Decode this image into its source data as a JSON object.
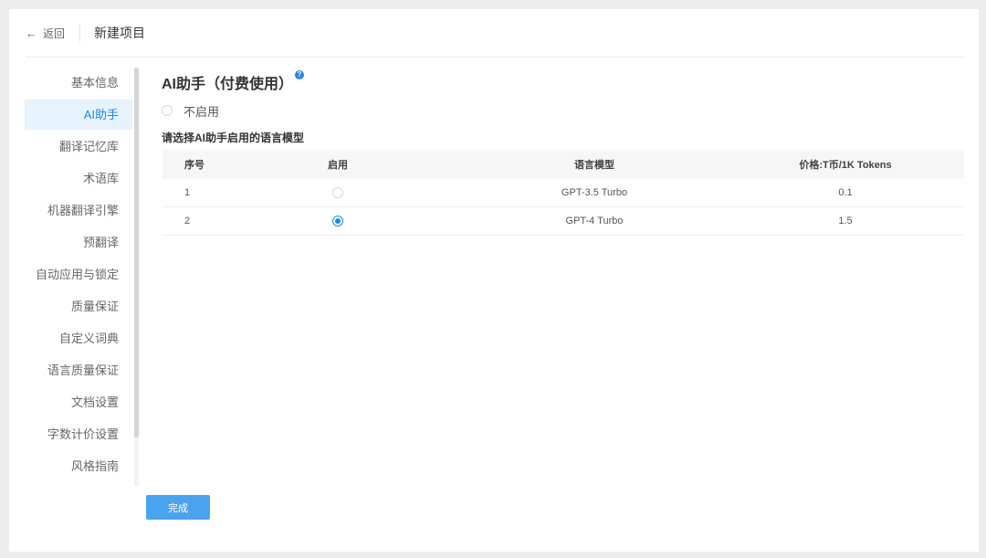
{
  "header": {
    "back_label": "返回",
    "title": "新建项目"
  },
  "sidebar": {
    "items": [
      {
        "label": "基本信息",
        "active": false
      },
      {
        "label": "AI助手",
        "active": true
      },
      {
        "label": "翻译记忆库",
        "active": false
      },
      {
        "label": "术语库",
        "active": false
      },
      {
        "label": "机器翻译引擎",
        "active": false
      },
      {
        "label": "预翻译",
        "active": false
      },
      {
        "label": "自动应用与锁定",
        "active": false
      },
      {
        "label": "质量保证",
        "active": false
      },
      {
        "label": "自定义词典",
        "active": false
      },
      {
        "label": "语言质量保证",
        "active": false
      },
      {
        "label": "文档设置",
        "active": false
      },
      {
        "label": "字数计价设置",
        "active": false
      },
      {
        "label": "风格指南",
        "active": false
      }
    ]
  },
  "main": {
    "title": "AI助手（付费使用）",
    "help_icon": "question-icon",
    "disable_option": "不启用",
    "model_section_label": "请选择AI助手启用的语言模型",
    "table": {
      "columns": [
        "序号",
        "启用",
        "语言模型",
        "价格:T币/1K Tokens"
      ],
      "rows": [
        {
          "index": "1",
          "enabled": false,
          "model": "GPT-3.5 Turbo",
          "price": "0.1"
        },
        {
          "index": "2",
          "enabled": true,
          "model": "GPT-4 Turbo",
          "price": "1.5"
        }
      ]
    }
  },
  "footer": {
    "done_label": "完成"
  },
  "colors": {
    "accent": "#1e88e5",
    "button": "#4aa3ef",
    "active_bg": "#e6f2fc"
  }
}
